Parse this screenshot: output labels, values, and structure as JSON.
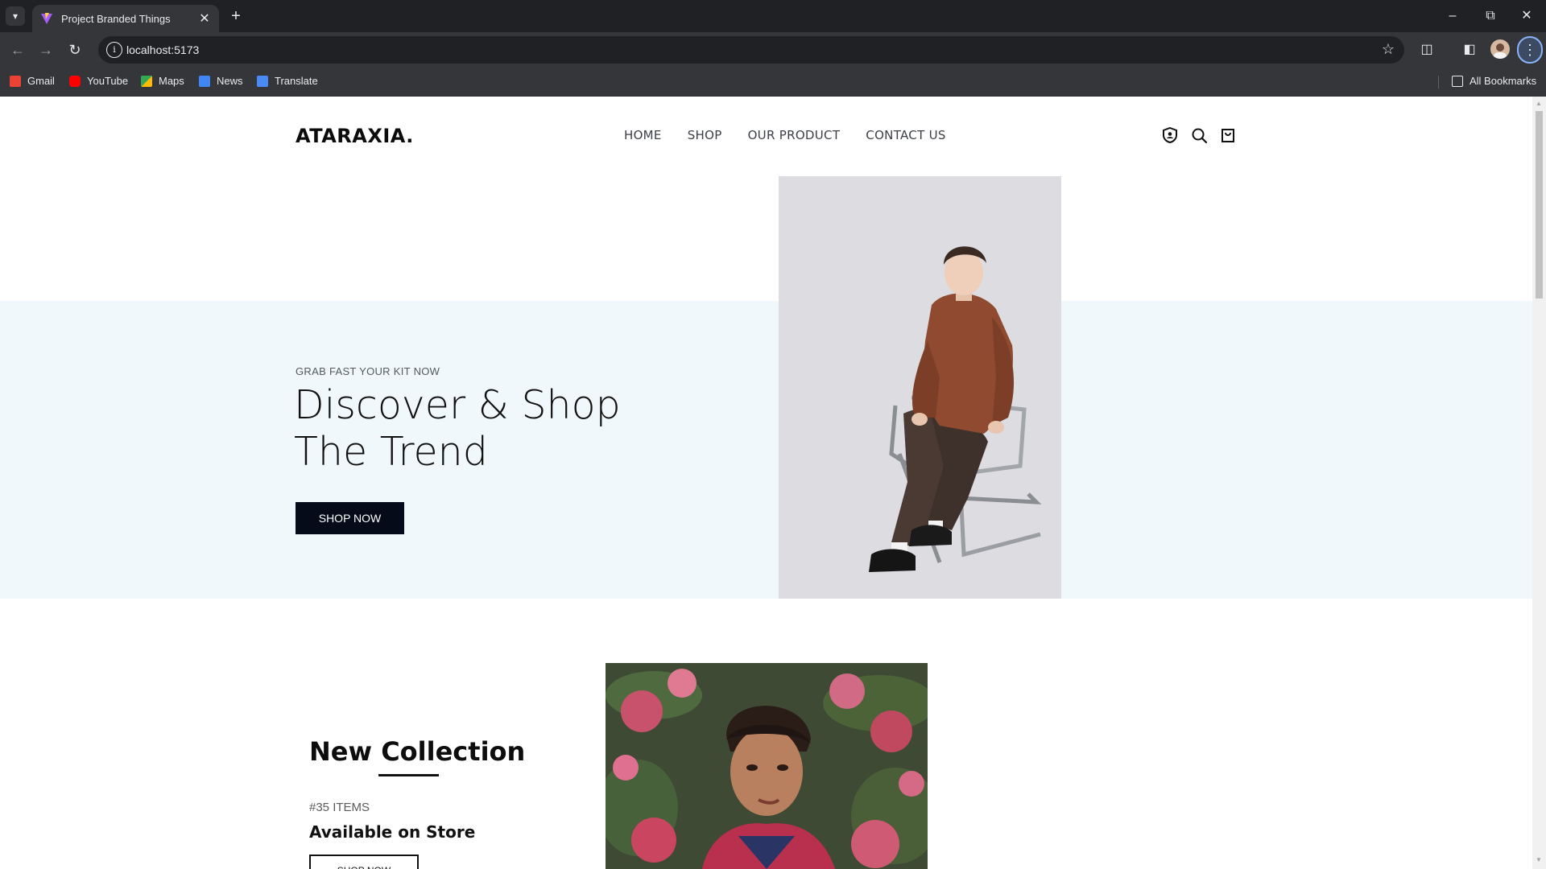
{
  "browser": {
    "tab_title": "Project Branded Things",
    "url": "localhost:5173",
    "bookmarks": [
      "Gmail",
      "YouTube",
      "Maps",
      "News",
      "Translate"
    ],
    "all_bookmarks": "All Bookmarks"
  },
  "site": {
    "logo": "ATARAXIA.",
    "nav": [
      "HOME",
      "SHOP",
      "OUR PRODUCT",
      "CONTACT US"
    ]
  },
  "hero": {
    "subtitle": "GRAB FAST YOUR KIT NOW",
    "title_line1": "Discover & Shop",
    "title_line2": "The Trend",
    "button": "SHOP NOW"
  },
  "collection": {
    "title": "New Collection",
    "count": "#35 ITEMS",
    "availability": "Available on Store",
    "button": "SHOP NOW"
  },
  "colors": {
    "hero_band": "#f0f8fb",
    "primary_button": "#060b1a",
    "jacket": "#8f4a30"
  }
}
